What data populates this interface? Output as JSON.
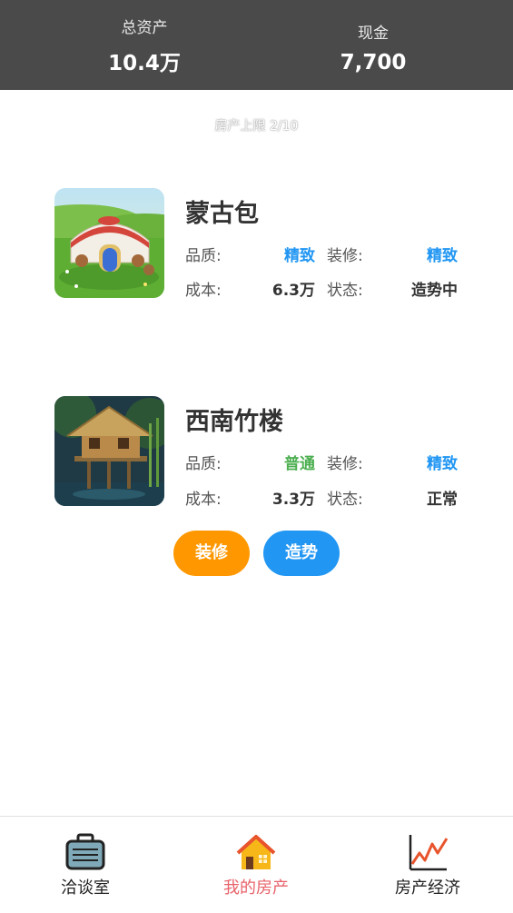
{
  "header": {
    "total_assets_label": "总资产",
    "total_assets_value": "10.4万",
    "cash_label": "现金",
    "cash_value": "7,700"
  },
  "property_limit": "房产上限 2/10",
  "properties": [
    {
      "name": "蒙古包",
      "image": "yurt-image",
      "quality_label": "品质:",
      "quality_value": "精致",
      "quality_color": "#2196f3",
      "decoration_label": "装修:",
      "decoration_value": "精致",
      "decoration_color": "#2196f3",
      "cost_label": "成本:",
      "cost_value": "6.3万",
      "status_label": "状态:",
      "status_value": "造势中"
    },
    {
      "name": "西南竹楼",
      "image": "bamboo-house-image",
      "quality_label": "品质:",
      "quality_value": "普通",
      "quality_color": "#4caf50",
      "decoration_label": "装修:",
      "decoration_value": "精致",
      "decoration_color": "#2196f3",
      "cost_label": "成本:",
      "cost_value": "3.3万",
      "status_label": "状态:",
      "status_value": "正常"
    }
  ],
  "actions": {
    "decorate_label": "装修",
    "decorate_color": "#ff9800",
    "hype_label": "造势",
    "hype_color": "#2196f3"
  },
  "tabbar": {
    "tabs": [
      {
        "label": "洽谈室",
        "icon": "briefcase-icon"
      },
      {
        "label": "我的房产",
        "icon": "house-icon",
        "active": true
      },
      {
        "label": "房产经济",
        "icon": "line-chart-icon"
      }
    ],
    "active_color": "#e8626a"
  }
}
